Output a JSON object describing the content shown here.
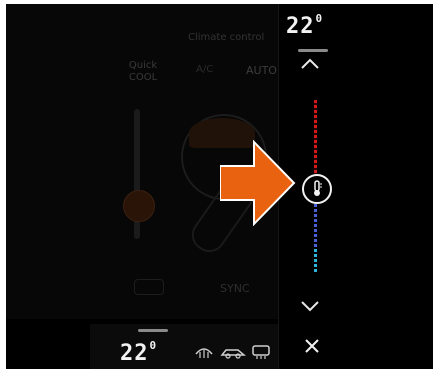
{
  "climate": {
    "background": {
      "title": "Climate control",
      "quick_cool": "Quick\nCOOL",
      "ac": "A/C",
      "auto": "AUTO",
      "sync": "SYNC"
    },
    "temperature_panel": {
      "value": "22",
      "decimal": "0",
      "up_icon": "chevron-up-icon",
      "down_icon": "chevron-down-icon",
      "close_icon": "close-icon",
      "slider_icon": "thermometer-icon"
    },
    "bottom_bar": {
      "value": "22",
      "decimal": "0",
      "icons": [
        "rear-defrost-icon",
        "recirculation-icon",
        "rear-window-heat-icon"
      ]
    },
    "highlight_arrow": "arrow-right-icon",
    "colors": {
      "arrow": "#E8620F",
      "warm": "#D21A1A",
      "cool": "#2FB4D6",
      "text": "#F2F2F2"
    }
  }
}
